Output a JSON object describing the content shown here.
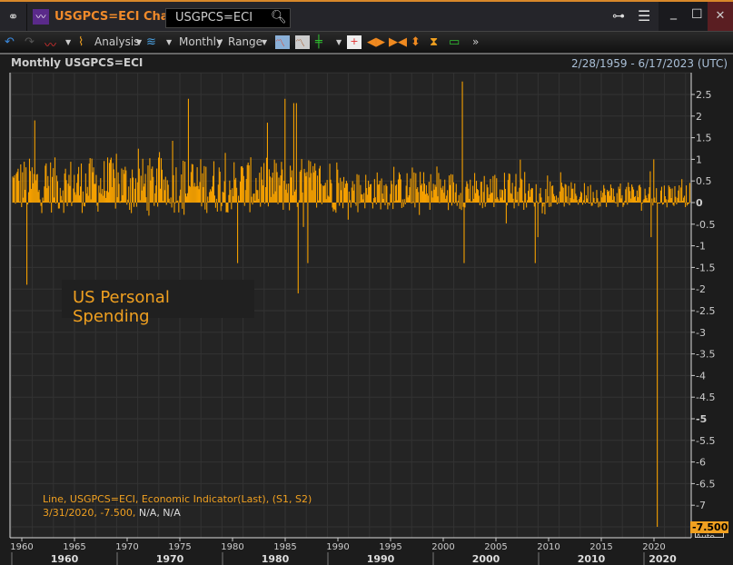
{
  "window": {
    "title": "USGPCS=ECI Chart",
    "search_value": "USGPCS=ECI",
    "icons": [
      "link-icon",
      "chart-app-icon",
      "search-icon",
      "hierarchy-icon",
      "menu-icon",
      "minimize-icon",
      "maximize-icon",
      "close-icon"
    ]
  },
  "toolbar": {
    "analysis": "Analysis",
    "interval": "Monthly",
    "range": "Range"
  },
  "chart": {
    "header": "Monthly USGPCS=ECI",
    "date_range": "2/28/1959 - 6/17/2023 (UTC)",
    "series_label": "US Personal Spending",
    "legend_line1": "Line, USGPCS=ECI, Economic Indicator(Last), (S1, S2)",
    "legend_date_value": "3/31/2020, -7.500,",
    "legend_na": "N/A, N/A",
    "last_value": "-7.500",
    "auto_label": "Auto"
  },
  "chart_data": {
    "type": "bar",
    "title": "Monthly USGPCS=ECI",
    "series": [
      {
        "name": "US Personal Spending",
        "color": "#f5a000"
      }
    ],
    "x_range": [
      1959.1,
      2023.45
    ],
    "ylim": [
      -7.8,
      3.0
    ],
    "y_ticks": [
      "2.5",
      "2",
      "1.5",
      "1",
      "0.5",
      "0",
      "-0.5",
      "-1",
      "-1.5",
      "-2",
      "-2.5",
      "-3",
      "-3.5",
      "-4",
      "-4.5",
      "-5",
      "-5.5",
      "-6",
      "-6.5",
      "-7"
    ],
    "x_ticks": [
      "1960",
      "1965",
      "1970",
      "1975",
      "1980",
      "1985",
      "1990",
      "1995",
      "2000",
      "2005",
      "2010",
      "2015",
      "2020"
    ],
    "x_decades": [
      "1960",
      "1970",
      "1980",
      "1990",
      "2000",
      "2010",
      "2020"
    ],
    "notable_points": [
      {
        "x": 1960.4,
        "y": -1.9
      },
      {
        "x": 1961.2,
        "y": 1.9
      },
      {
        "x": 1975.8,
        "y": 2.4
      },
      {
        "x": 1980.4,
        "y": -1.4
      },
      {
        "x": 1984.9,
        "y": 2.4
      },
      {
        "x": 1985.8,
        "y": 2.3
      },
      {
        "x": 1986.0,
        "y": 2.3
      },
      {
        "x": 1986.2,
        "y": -2.1
      },
      {
        "x": 1987.1,
        "y": -1.4
      },
      {
        "x": 2001.8,
        "y": 2.8
      },
      {
        "x": 2001.9,
        "y": -1.4
      },
      {
        "x": 2008.7,
        "y": -1.4
      },
      {
        "x": 2008.9,
        "y": -0.8
      },
      {
        "x": 2019.9,
        "y": 1.0
      },
      {
        "x": 2019.7,
        "y": -0.8
      },
      {
        "x": 2020.25,
        "y": -7.5
      }
    ]
  }
}
